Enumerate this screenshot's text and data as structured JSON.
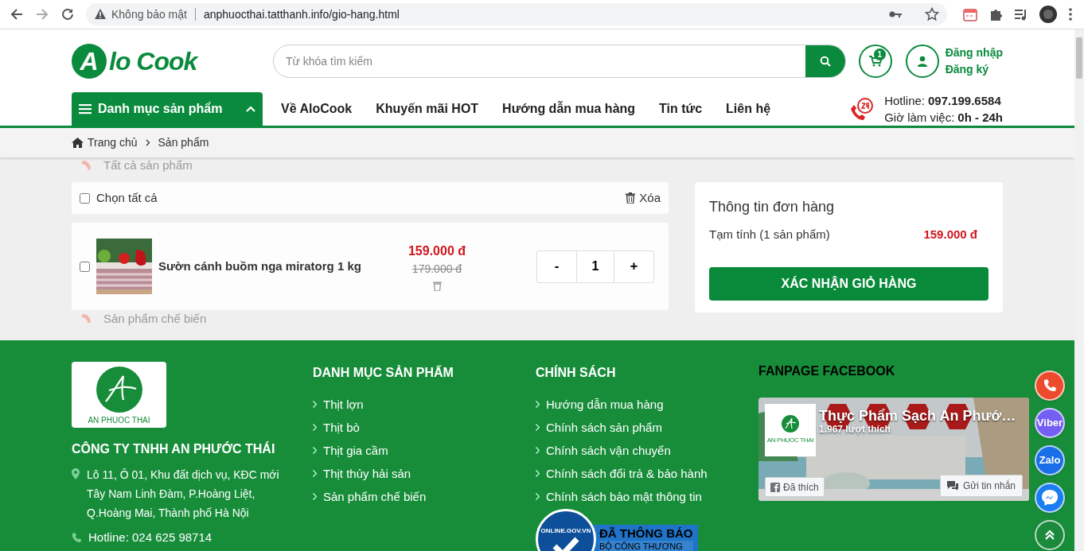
{
  "browser": {
    "security_label": "Không bảo mật",
    "url": "anphuocthai.tatthanh.info/gio-hang.html"
  },
  "header": {
    "logo_mark": "A",
    "logo_text": "lo Cook",
    "search": {
      "placeholder": "Từ khóa tìm kiếm"
    },
    "cart_count": "1",
    "login": "Đăng nhập",
    "register": "Đăng ký"
  },
  "nav": {
    "category_button": "Danh mục sản phẩm",
    "category_expanded": true,
    "links": [
      "Về AloCook",
      "Khuyến mãi HOT",
      "Hướng dẫn mua hàng",
      "Tin tức",
      "Liên hệ"
    ],
    "hotline_label": "Hotline:",
    "hotline": "097.199.6584",
    "hours_label": "Giờ làm việc:",
    "hours": "0h - 24h"
  },
  "breadcrumb": [
    "Trang chủ",
    "Sản phẩm"
  ],
  "category_menu": {
    "items": [
      "Tất cả sản phẩm",
      "Sản phẩm chế biến"
    ]
  },
  "cart": {
    "select_all": {
      "label": "Chọn tất cả",
      "checked": false
    },
    "delete": "Xóa",
    "items": [
      {
        "name": "Sườn cánh buồm nga miratorg 1 kg",
        "price": "159.000 đ",
        "old_price": "179.000 đ",
        "quantity": "1",
        "checked": false,
        "minus": "-",
        "plus": "+"
      }
    ]
  },
  "summary": {
    "title": "Thông tin đơn hàng",
    "subtotal_label": "Tạm tính (1 sản phẩm)",
    "subtotal": "159.000 đ",
    "confirm": "XÁC NHẬN GIỎ HÀNG"
  },
  "footer": {
    "logo_text": "AN PHUOC THAI",
    "company": "CÔNG TY TNHH AN PHƯỚC THÁI",
    "address": "Lô 11, Ô 01, Khu đất dịch vụ, KĐC mới Tây Nam Linh Đàm, P.Hoàng Liệt, Q.Hoàng Mai, Thành phố Hà Nội",
    "hotline": "Hotline: 024 625 98714",
    "columns": [
      {
        "title": "DANH MỤC SẢN PHẨM",
        "links": [
          "Thịt lợn",
          "Thịt bò",
          "Thịt gia cầm",
          "Thịt thủy hải sản",
          "Sản phẩm chế biến"
        ]
      },
      {
        "title": "CHÍNH SÁCH",
        "links": [
          "Hướng dẫn mua hàng",
          "Chính sách sản phẩm",
          "Chính sách vận chuyển",
          "Chính sách đổi trả & bảo hành",
          "Chính sách bảo mật thông tin"
        ]
      }
    ],
    "badge": {
      "arc": "ONLINE.GOV.VN",
      "title": "ĐÃ THÔNG BÁO",
      "subtitle": "BỘ CÔNG THƯƠNG"
    },
    "fanpage": {
      "title": "FANPAGE FACEBOOK",
      "page_name": "Thực Phẩm Sạch An Phướ…",
      "likes": "1.967 lượt thích",
      "logo_text": "AN PHUOC THAI",
      "liked_button": "Đã thích",
      "message_button": "Gửi tin nhắn"
    }
  },
  "float_buttons": [
    {
      "kind": "phone",
      "color": "#ee4a2d"
    },
    {
      "kind": "text",
      "label": "Viber",
      "color": "#7360f2"
    },
    {
      "kind": "text",
      "label": "Zalo",
      "color": "#1a6fe8"
    },
    {
      "kind": "messenger",
      "color": "#1a7ef0"
    },
    {
      "kind": "top",
      "color": "#1b8a3c"
    }
  ]
}
